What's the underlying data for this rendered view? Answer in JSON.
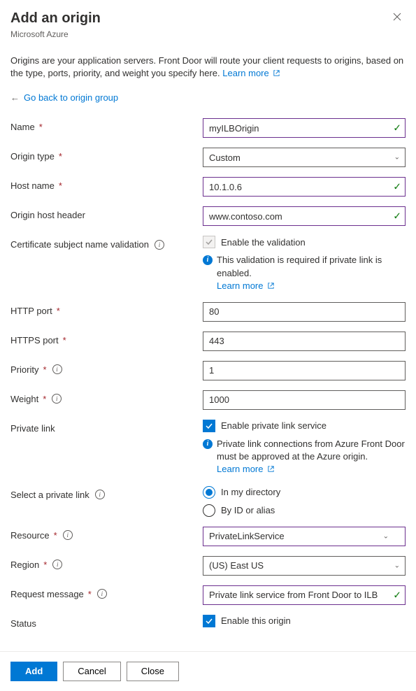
{
  "header": {
    "title": "Add an origin",
    "subtitle": "Microsoft Azure"
  },
  "description": "Origins are your application servers. Front Door will route your client requests to origins, based on the type, ports, priority, and weight you specify here.",
  "learnMoreLabel": "Learn more",
  "backLink": "Go back to origin group",
  "fields": {
    "name": {
      "label": "Name",
      "value": "myILBOrigin"
    },
    "originType": {
      "label": "Origin type",
      "value": "Custom"
    },
    "hostName": {
      "label": "Host name",
      "value": "10.1.0.6"
    },
    "originHostHeader": {
      "label": "Origin host header",
      "value": "www.contoso.com"
    },
    "certValidation": {
      "label": "Certificate subject name validation",
      "checkboxLabel": "Enable the validation",
      "note": "This validation is required if private link is enabled."
    },
    "httpPort": {
      "label": "HTTP port",
      "value": "80"
    },
    "httpsPort": {
      "label": "HTTPS port",
      "value": "443"
    },
    "priority": {
      "label": "Priority",
      "value": "1"
    },
    "weight": {
      "label": "Weight",
      "value": "1000"
    },
    "privateLink": {
      "label": "Private link",
      "checkboxLabel": "Enable private link service",
      "note": "Private link connections from Azure Front Door must be approved at the Azure origin."
    },
    "selectPrivateLink": {
      "label": "Select a private link",
      "options": {
        "directory": "In my directory",
        "alias": "By ID or alias"
      }
    },
    "resource": {
      "label": "Resource",
      "value": "PrivateLinkService"
    },
    "region": {
      "label": "Region",
      "value": "(US) East US"
    },
    "requestMessage": {
      "label": "Request message",
      "value": "Private link service from Front Door to ILB"
    },
    "status": {
      "label": "Status",
      "checkboxLabel": "Enable this origin"
    }
  },
  "footer": {
    "add": "Add",
    "cancel": "Cancel",
    "close": "Close"
  }
}
